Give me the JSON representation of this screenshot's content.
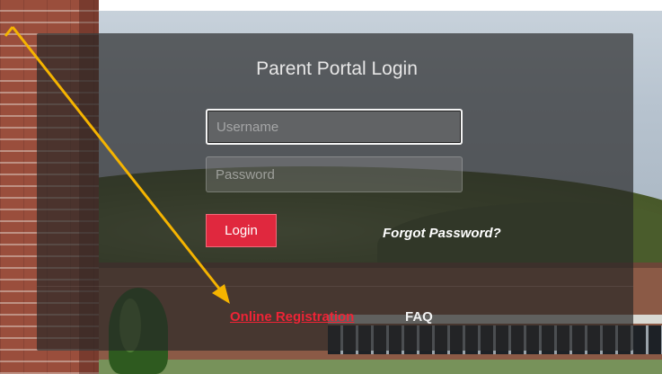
{
  "login": {
    "title": "Parent Portal Login",
    "username": {
      "value": "",
      "placeholder": "Username"
    },
    "password": {
      "value": "",
      "placeholder": "Password"
    },
    "login_button": "Login",
    "forgot_password": "Forgot Password?"
  },
  "footer_links": {
    "online_registration": "Online Registration",
    "faq": "FAQ"
  },
  "colors": {
    "login_button": "#e0283e",
    "registration_link": "#ee2436",
    "annotation_arrow": "#f5b400",
    "panel_overlay": "#262626"
  }
}
